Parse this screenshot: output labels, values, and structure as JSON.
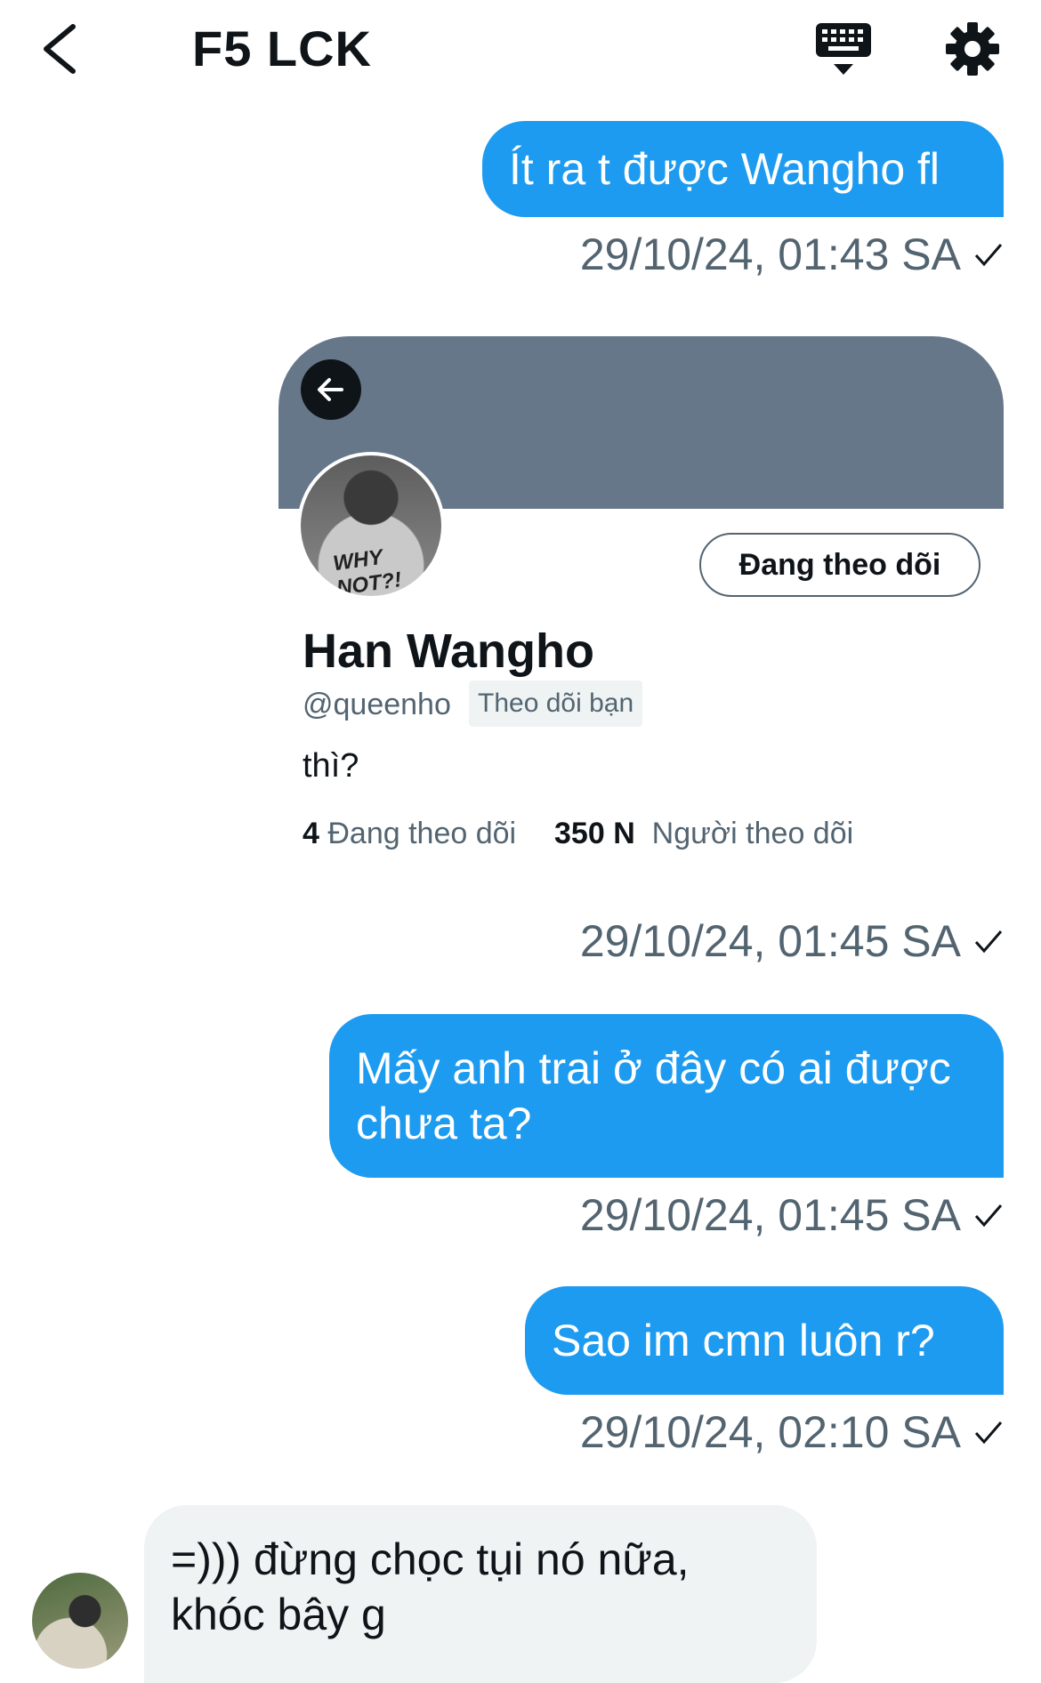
{
  "header": {
    "title": "F5 LCK",
    "back_icon": "chevron-left-icon",
    "keyboard_icon": "keyboard-icon",
    "settings_icon": "gear-icon"
  },
  "messages": [
    {
      "text": "Ít ra t được Wangho fl",
      "time": "29/10/24, 01:43 SA"
    },
    {
      "time": "29/10/24, 01:45 SA"
    },
    {
      "text": "Mấy anh trai ở đây có ai được chưa ta?",
      "time": "29/10/24, 01:45 SA"
    },
    {
      "text": "Sao im cmn luôn r?",
      "time": "29/10/24, 02:10 SA"
    },
    {
      "text": "=))) đừng chọc tụi nó nữa, khóc bây g"
    }
  ],
  "profile_card": {
    "name": "Han Wangho",
    "handle": "@queenho",
    "follows_you": "Theo dõi bạn",
    "bio": "thì?",
    "following_count": "4",
    "following_label": "Đang theo dõi",
    "followers_count": "350 N",
    "followers_label": "Người theo dõi",
    "follow_button": "Đang theo dõi",
    "avatar_text": "WHY NOT?!"
  },
  "colors": {
    "accent": "#1d9bf0",
    "banner": "#66778a",
    "secondary_text": "#536471",
    "incoming_bubble": "#eff3f4"
  }
}
